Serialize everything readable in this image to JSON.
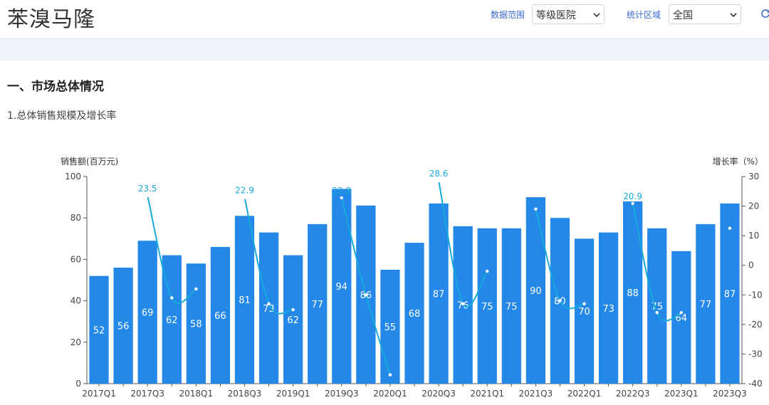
{
  "page": {
    "title": "苯溴马隆",
    "filters": {
      "range_label": "数据范围",
      "range_value": "等级医院",
      "region_label": "统计区域",
      "region_value": "全国"
    },
    "section_title": "一、市场总体情况",
    "sub_title": "1.总体销售规模及增长率"
  },
  "chart_data": {
    "type": "bar",
    "categories": [
      "2017Q1",
      "2017Q2",
      "2017Q3",
      "2017Q4",
      "2018Q1",
      "2018Q2",
      "2018Q3",
      "2018Q4",
      "2019Q1",
      "2019Q2",
      "2019Q3",
      "2019Q4",
      "2020Q1",
      "2020Q2",
      "2020Q3",
      "2020Q4",
      "2021Q1",
      "2021Q2",
      "2021Q3",
      "2021Q4",
      "2022Q1",
      "2022Q2",
      "2022Q3",
      "2022Q4",
      "2023Q1",
      "2023Q2",
      "2023Q3"
    ],
    "x_tick_labels": [
      "2017Q1",
      "2017Q3",
      "2018Q1",
      "2018Q3",
      "2019Q1",
      "2019Q3",
      "2020Q1",
      "2020Q3",
      "2021Q1",
      "2021Q3",
      "2022Q1",
      "2022Q3",
      "2023Q1",
      "2023Q3"
    ],
    "series": [
      {
        "name": "销售额",
        "kind": "bar",
        "axis": "left",
        "color": "#2388e8",
        "values": [
          52,
          56,
          69,
          62,
          58,
          66,
          81,
          73,
          62,
          77,
          94,
          86,
          55,
          68,
          87,
          76,
          75,
          75,
          90,
          80,
          70,
          73,
          88,
          75,
          64,
          77,
          87
        ]
      },
      {
        "name": "增长率",
        "kind": "line",
        "axis": "right",
        "color": "#17a9d8",
        "values": [
          null,
          null,
          23.5,
          -11,
          -8,
          null,
          22.9,
          -13,
          -15,
          null,
          22.8,
          -10,
          -37,
          null,
          28.6,
          -13,
          -2,
          null,
          19,
          -12,
          -13,
          null,
          20.9,
          -16,
          -16,
          null,
          12.5
        ],
        "labeled": [
          2,
          6,
          10,
          14,
          22
        ]
      }
    ],
    "ylabel_left": "销售额(百万元)",
    "ylabel_right": "增长率（%）",
    "ylim_left": [
      0,
      100
    ],
    "yticks_left": [
      0,
      20,
      40,
      60,
      80,
      100
    ],
    "ylim_right": [
      -40,
      30
    ],
    "yticks_right": [
      -40,
      -30,
      -20,
      -10,
      0,
      10,
      20,
      30
    ],
    "grid": false
  },
  "colors": {
    "accent": "#3a6ad4",
    "band": "#eef2fa",
    "bar": "#2388e8",
    "line": "#17a9d8"
  }
}
